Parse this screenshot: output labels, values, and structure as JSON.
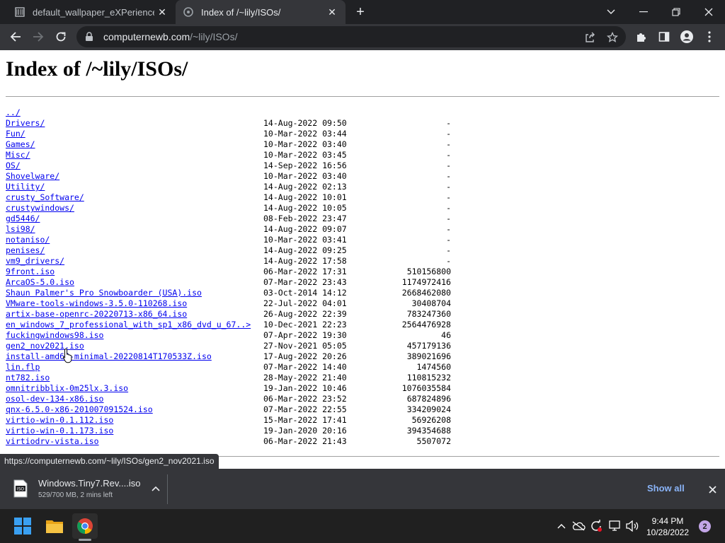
{
  "browser": {
    "tabs": [
      {
        "title": "default_wallpaper_eXPerience.jpg",
        "active": false
      },
      {
        "title": "Index of /~lily/ISOs/",
        "active": true
      }
    ],
    "url_host": "computernewb.com",
    "url_path": "/~lily/ISOs/"
  },
  "page": {
    "title": "Index of /~lily/ISOs/",
    "entries": [
      {
        "name": "../",
        "date": "",
        "size": ""
      },
      {
        "name": "Drivers/",
        "date": "14-Aug-2022 09:50",
        "size": "-"
      },
      {
        "name": "Fun/",
        "date": "10-Mar-2022 03:44",
        "size": "-"
      },
      {
        "name": "Games/",
        "date": "10-Mar-2022 03:40",
        "size": "-"
      },
      {
        "name": "Misc/",
        "date": "10-Mar-2022 03:45",
        "size": "-"
      },
      {
        "name": "OS/",
        "date": "14-Sep-2022 16:56",
        "size": "-"
      },
      {
        "name": "Shovelware/",
        "date": "10-Mar-2022 03:40",
        "size": "-"
      },
      {
        "name": "Utility/",
        "date": "14-Aug-2022 02:13",
        "size": "-"
      },
      {
        "name": "crusty_Software/",
        "date": "14-Aug-2022 10:01",
        "size": "-"
      },
      {
        "name": "crustywindows/",
        "date": "14-Aug-2022 10:05",
        "size": "-"
      },
      {
        "name": "gd5446/",
        "date": "08-Feb-2022 23:47",
        "size": "-"
      },
      {
        "name": "lsi98/",
        "date": "14-Aug-2022 09:07",
        "size": "-"
      },
      {
        "name": "notaniso/",
        "date": "10-Mar-2022 03:41",
        "size": "-"
      },
      {
        "name": "penises/",
        "date": "14-Aug-2022 09:25",
        "size": "-"
      },
      {
        "name": "vm9_drivers/",
        "date": "14-Aug-2022 17:58",
        "size": "-"
      },
      {
        "name": "9front.iso",
        "date": "06-Mar-2022 17:31",
        "size": "510156800"
      },
      {
        "name": "ArcaOS-5.0.iso",
        "date": "07-Mar-2022 23:43",
        "size": "1174972416"
      },
      {
        "name": "Shaun Palmer's Pro Snowboarder (USA).iso",
        "date": "03-Oct-2014 14:12",
        "size": "2668462080"
      },
      {
        "name": "VMware-tools-windows-3.5.0-110268.iso",
        "date": "22-Jul-2022 04:01",
        "size": "30408704"
      },
      {
        "name": "artix-base-openrc-20220713-x86_64.iso",
        "date": "26-Aug-2022 22:39",
        "size": "783247360"
      },
      {
        "name": "en_windows_7_professional_with_sp1_x86_dvd_u_67..>",
        "date": "10-Dec-2021 22:23",
        "size": "2564476928"
      },
      {
        "name": "fuckingwindows98.iso",
        "date": "07-Apr-2022 19:30",
        "size": "46"
      },
      {
        "name": "gen2_nov2021.iso",
        "date": "27-Nov-2021 05:05",
        "size": "457179136"
      },
      {
        "name": "install-amd64-minimal-20220814T170533Z.iso",
        "date": "17-Aug-2022 20:26",
        "size": "389021696"
      },
      {
        "name": "lin.flp",
        "date": "07-Mar-2022 14:40",
        "size": "1474560"
      },
      {
        "name": "nt782.iso",
        "date": "28-May-2022 21:40",
        "size": "110815232"
      },
      {
        "name": "omnitribblix-0m25lx.3.iso",
        "date": "19-Jan-2022 10:46",
        "size": "1076035584"
      },
      {
        "name": "osol-dev-134-x86.iso",
        "date": "06-Mar-2022 23:52",
        "size": "687824896"
      },
      {
        "name": "qnx-6.5.0-x86-201007091524.iso",
        "date": "07-Mar-2022 22:55",
        "size": "334209024"
      },
      {
        "name": "virtio-win-0.1.112.iso",
        "date": "15-Mar-2022 17:41",
        "size": "56926208"
      },
      {
        "name": "virtio-win-0.1.173.iso",
        "date": "19-Jan-2020 20:16",
        "size": "394354688"
      },
      {
        "name": "virtiodrv-vista.iso",
        "date": "06-Mar-2022 21:43",
        "size": "5507072"
      }
    ]
  },
  "status_bubble": "https://computernewb.com/~lily/ISOs/gen2_nov2021.iso",
  "downloads": {
    "filename": "Windows.Tiny7.Rev....iso",
    "progress": "529/700 MB, 2 mins left",
    "show_all": "Show all"
  },
  "taskbar": {
    "time": "9:44 PM",
    "date": "10/28/2022",
    "notifications": "2"
  },
  "colors": {
    "link": "#0000ee",
    "chrome_dark": "#202124",
    "chrome_toolbar": "#35363a",
    "accent_blue": "#8ab4f8"
  }
}
